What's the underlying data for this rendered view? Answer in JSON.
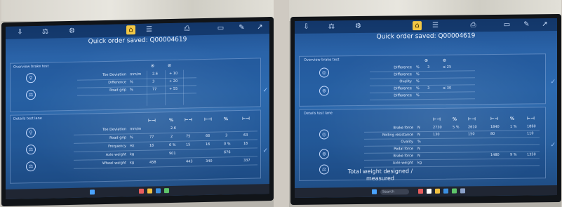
{
  "left": {
    "title": "Quick order saved: Q00004619",
    "panel_top_label": "Overview brake test",
    "panel_bottom_label": "Details test lane",
    "top_rows": [
      {
        "label": "Toe Deviation",
        "unit": "mm/m",
        "v1": "2.6",
        "v2": "+ 10"
      },
      {
        "label": "Difference",
        "unit": "%",
        "v1": "3",
        "v2": "+ 20"
      },
      {
        "label": "Road grip",
        "unit": "%",
        "v1": "77",
        "v2": "+ 55"
      }
    ],
    "bottom_rows": [
      {
        "label": "Toe Deviation",
        "unit": "mm/m",
        "a": "",
        "b": "2.6",
        "c": "",
        "d": "",
        "e": "",
        "f": ""
      },
      {
        "label": "Road grip",
        "unit": "%",
        "a": "77",
        "b": "2",
        "c": "75",
        "d": "66",
        "e": "3",
        "f": "63"
      },
      {
        "label": "Frequency",
        "unit": "Hz",
        "a": "16",
        "b": "6 %",
        "c": "15",
        "d": "16",
        "e": "0 %",
        "f": "16"
      },
      {
        "label": "Axle weight",
        "unit": "kg",
        "a": "",
        "b": "901",
        "c": "",
        "d": "",
        "e": "676",
        "f": ""
      },
      {
        "label": "Wheel weight",
        "unit": "kg",
        "a": "458",
        "b": "",
        "c": "443",
        "d": "340",
        "e": "",
        "f": "337"
      }
    ],
    "bottom_headers": [
      "⊢⊣",
      "%",
      "⊢⊣",
      "⊢⊣",
      "%",
      "⊢⊣"
    ]
  },
  "right": {
    "title": "Quick order saved: Q00004619",
    "panel_top_label": "Overview brake test",
    "panel_bottom_label": "Details test lane",
    "top_rows": [
      {
        "label": "Difference",
        "unit": "%",
        "v1": "3",
        "v2": "≤ 25"
      },
      {
        "label": "Difference",
        "unit": "%",
        "v1": "",
        "v2": ""
      },
      {
        "label": "Ovality",
        "unit": "%",
        "v1": "",
        "v2": ""
      },
      {
        "label": "Difference",
        "unit": "%",
        "v1": "3",
        "v2": "≤ 30"
      },
      {
        "label": "Difference",
        "unit": "%",
        "v1": "",
        "v2": ""
      }
    ],
    "bottom_rows": [
      {
        "label": "Brake force",
        "unit": "N",
        "a": "2730",
        "b": "5 %",
        "c": "2610",
        "d": "1840",
        "e": "1 %",
        "f": "1860"
      },
      {
        "label": "Rolling resistance",
        "unit": "N",
        "a": "130",
        "b": "",
        "c": "150",
        "d": "80",
        "e": "",
        "f": "110"
      },
      {
        "label": "Ovality",
        "unit": "%",
        "a": "",
        "b": "",
        "c": "",
        "d": "",
        "e": "",
        "f": ""
      },
      {
        "label": "Pedal force",
        "unit": "N",
        "a": "",
        "b": "",
        "c": "",
        "d": "",
        "e": "",
        "f": ""
      },
      {
        "label": "Brake force",
        "unit": "N",
        "a": "",
        "b": "",
        "c": "",
        "d": "1480",
        "e": "9 %",
        "f": "1350"
      },
      {
        "label": "Axle weight",
        "unit": "kg",
        "a": "",
        "b": "",
        "c": "",
        "d": "",
        "e": "",
        "f": ""
      }
    ],
    "bottom_headers": [
      "⊢⊣",
      "%",
      "⊢⊣",
      "⊢⊣",
      "%",
      "⊢⊣"
    ],
    "total_weight": "Total weight designed / measured",
    "search_label": "Search"
  }
}
